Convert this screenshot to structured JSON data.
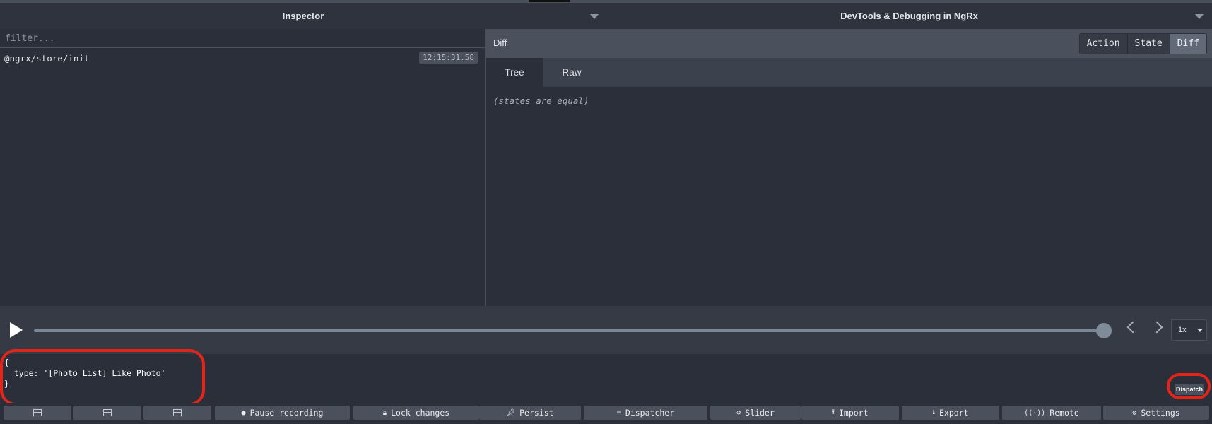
{
  "header": {
    "left_monitor": "Inspector",
    "right_monitor": "DevTools & Debugging in NgRx"
  },
  "inspector": {
    "filter_placeholder": "filter...",
    "actions": [
      {
        "name": "@ngrx/store/init",
        "time": "12:15:31.58"
      }
    ]
  },
  "detail": {
    "title": "Diff",
    "segments": [
      "Action",
      "State",
      "Diff"
    ],
    "active_segment": "Diff",
    "tabs": [
      "Tree",
      "Raw"
    ],
    "active_tab": "Tree",
    "message": "(states are equal)"
  },
  "playback": {
    "speed": "1x",
    "slider_position": 1.0
  },
  "dispatcher": {
    "code": "{\n  type: '[Photo List] Like Photo'\n}",
    "dispatch_label": "Dispatch"
  },
  "toolbar": {
    "buttons": [
      {
        "label": "Pause recording",
        "icon": "record-icon"
      },
      {
        "label": "Lock changes",
        "icon": "lock-icon"
      },
      {
        "label": "Persist",
        "icon": "pin-icon"
      },
      {
        "label": "Dispatcher",
        "icon": "keyboard-icon"
      },
      {
        "label": "Slider",
        "icon": "slider-icon"
      },
      {
        "label": "Import",
        "icon": "upload-icon"
      },
      {
        "label": "Export",
        "icon": "download-icon"
      },
      {
        "label": "Remote",
        "icon": "antenna-icon"
      },
      {
        "label": "Settings",
        "icon": "gear-icon"
      }
    ]
  },
  "colors": {
    "background": "#2a2f3a",
    "panel": "#4b515c",
    "highlight": "#e3241b"
  }
}
